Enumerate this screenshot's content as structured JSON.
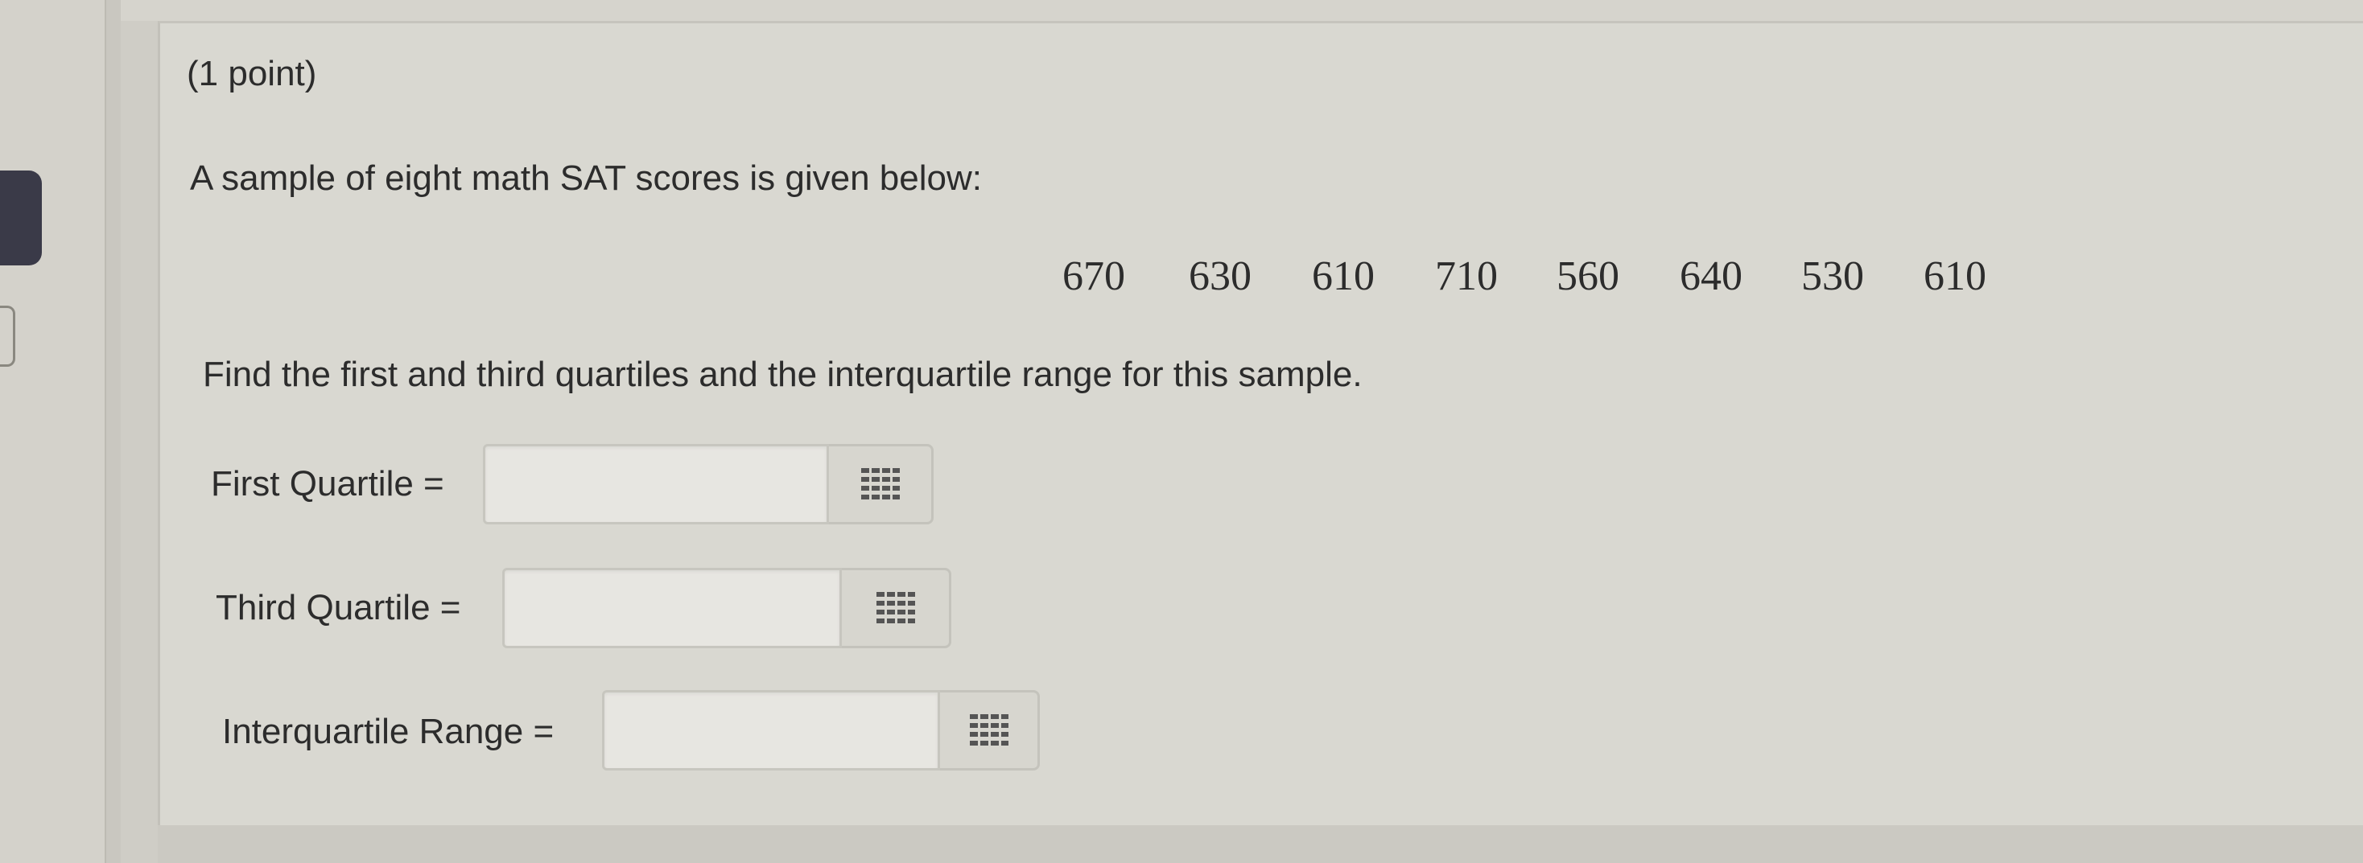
{
  "problem": {
    "points_label": "(1 point)",
    "intro": "A sample of eight math SAT scores is given below:",
    "scores": [
      "670",
      "630",
      "610",
      "710",
      "560",
      "640",
      "530",
      "610"
    ],
    "instruction": "Find the first and third quartiles and the interquartile range for this sample."
  },
  "fields": [
    {
      "label": "First Quartile =",
      "value": "",
      "matrix_icon": "matrix-grid-icon"
    },
    {
      "label": "Third Quartile =",
      "value": "",
      "matrix_icon": "matrix-grid-icon"
    },
    {
      "label": "Interquartile Range =",
      "value": "",
      "matrix_icon": "matrix-grid-icon"
    }
  ],
  "colors": {
    "page_background": "#d9d8d1",
    "input_background": "#e7e6e1",
    "text": "#2c2c2c",
    "nav_tab": "#3a3a48"
  }
}
